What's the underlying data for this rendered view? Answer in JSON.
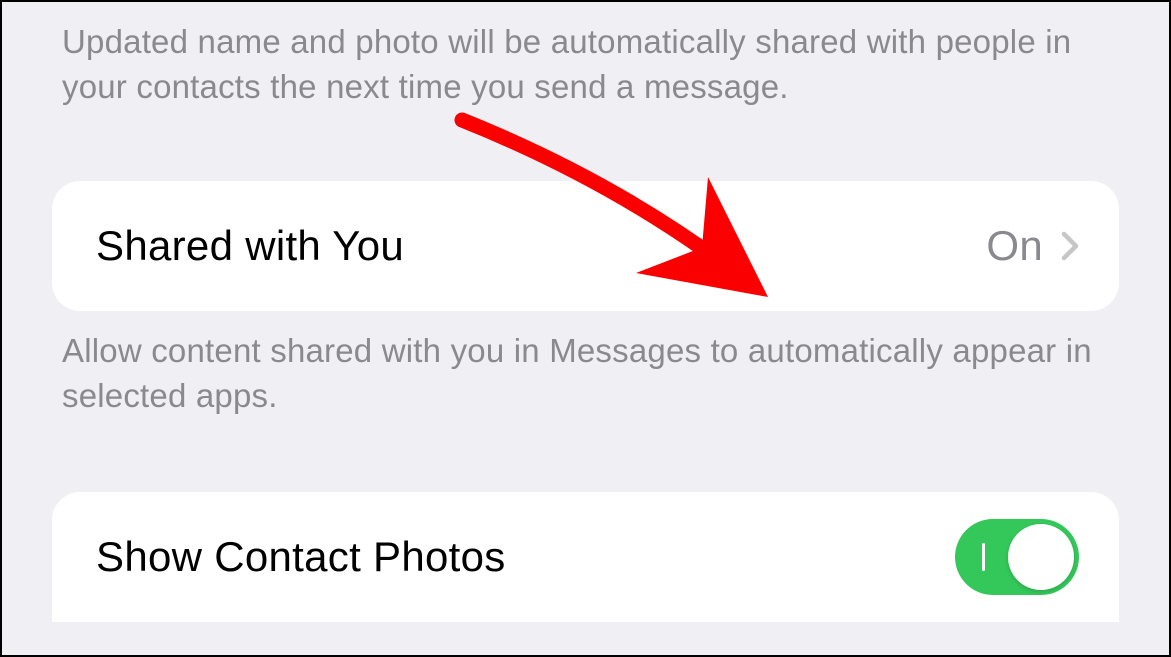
{
  "section1_footer": "Updated name and photo will be automatically shared with people in your contacts the next time you send a message.",
  "shared_with_you": {
    "label": "Shared with You",
    "value": "On"
  },
  "shared_with_you_footer": "Allow content shared with you in Messages to automatically appear in selected apps.",
  "show_contact_photos": {
    "label": "Show Contact Photos",
    "enabled": true
  }
}
